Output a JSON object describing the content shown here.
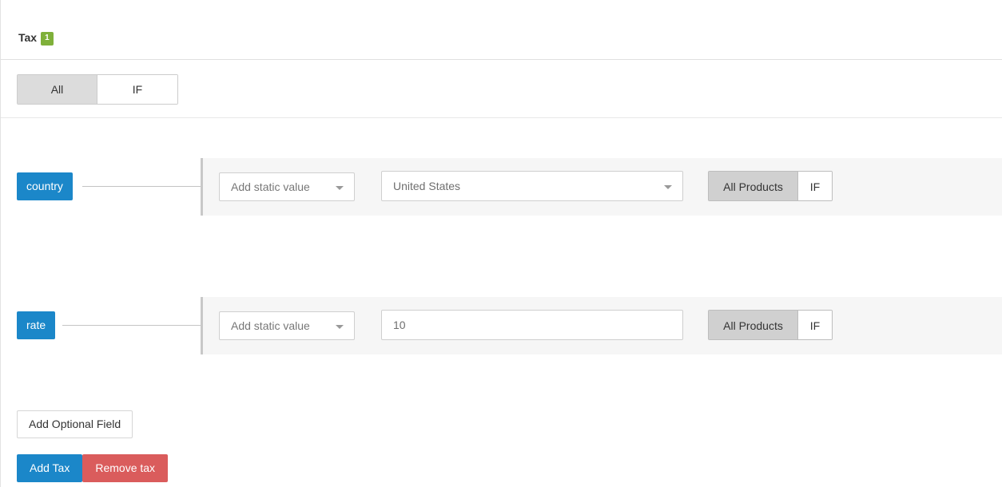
{
  "header": {
    "title": "Tax",
    "badge_count": "1"
  },
  "mode_toggle": {
    "options": [
      {
        "label": "All",
        "active": true
      },
      {
        "label": "IF",
        "active": false
      }
    ]
  },
  "rows": [
    {
      "tag_label": "country",
      "source_select": {
        "value": "Add static value",
        "caret_icon": "chevron-down-icon"
      },
      "value_control": {
        "type": "select",
        "value": "United States",
        "caret_icon": "chevron-down-icon"
      },
      "scope_toggle": {
        "options": [
          {
            "label": "All Products",
            "active": true
          },
          {
            "label": "IF",
            "active": false
          }
        ]
      }
    },
    {
      "tag_label": "rate",
      "source_select": {
        "value": "Add static value",
        "caret_icon": "chevron-down-icon"
      },
      "value_control": {
        "type": "text",
        "value": "10",
        "placeholder": ""
      },
      "scope_toggle": {
        "options": [
          {
            "label": "All Products",
            "active": true
          },
          {
            "label": "IF",
            "active": false
          }
        ]
      }
    }
  ],
  "footer": {
    "add_optional_field_label": "Add Optional Field",
    "add_tax_label": "Add Tax",
    "remove_tax_label": "Remove tax"
  },
  "colors": {
    "tag_blue": "#1b87c9",
    "badge_green": "#7fb03a",
    "primary_blue": "#1b87c9",
    "danger_red": "#da5c5c",
    "row_panel_bg": "#f6f6f6",
    "row_panel_bar": "#c8c8c8",
    "active_segment": "#dcdcdc"
  }
}
